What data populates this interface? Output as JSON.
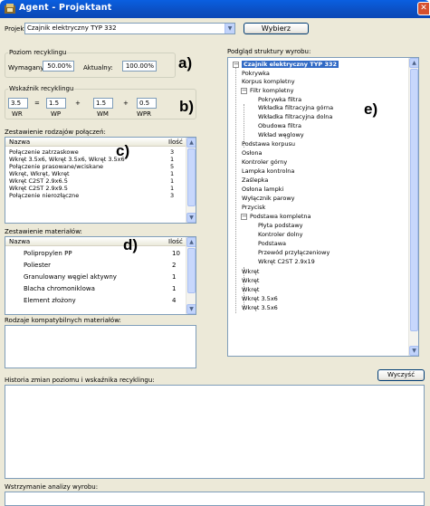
{
  "window": {
    "title": "Agent - Projektant",
    "close_glyph": "✕"
  },
  "project": {
    "label": "Projekt:",
    "value": "Czajnik elektryczny TYP 332",
    "browse_button": "Wybierz"
  },
  "recycling_level": {
    "group": "Poziom recyklingu",
    "required_label": "Wymagany:",
    "required_value": "50.00%",
    "current_label": "Aktualny:",
    "current_value": "100.00%"
  },
  "recycling_index": {
    "group": "Wskaźnik recyklingu",
    "values": [
      "3.5",
      "1.5",
      "1.5",
      "0.5"
    ],
    "operators": [
      "=",
      "+",
      "+"
    ],
    "labels": [
      "WR",
      "WP",
      "WM",
      "WPR"
    ]
  },
  "connections": {
    "title": "Zestawienie rodzajów połączeń:",
    "headers": [
      "Nazwa",
      "Ilość"
    ],
    "rows": [
      {
        "name": "Połączenie zatrzaskowe",
        "qty": "3"
      },
      {
        "name": "Wkręt 3.5x6, Wkręt 3.5x6, Wkręt 3.5x6",
        "qty": "1"
      },
      {
        "name": "Połączenie prasowane/wciskane",
        "qty": "5"
      },
      {
        "name": "Wkręt, Wkręt, Wkręt",
        "qty": "1"
      },
      {
        "name": "Wkręt C2ST 2.9x6.5",
        "qty": "1"
      },
      {
        "name": "Wkręt C2ST 2.9x9.5",
        "qty": "1"
      },
      {
        "name": "Połączenie nierozłączne",
        "qty": "3"
      }
    ]
  },
  "materials": {
    "title": "Zestawienie materiałów:",
    "headers": [
      "Nazwa",
      "Ilość"
    ],
    "rows": [
      {
        "name": "Polipropylen PP",
        "qty": "10"
      },
      {
        "name": "Poliester",
        "qty": "2"
      },
      {
        "name": "Granulowany węgiel aktywny",
        "qty": "1"
      },
      {
        "name": "Blacha chromoniklowa",
        "qty": "1"
      },
      {
        "name": "Element złożony",
        "qty": "4"
      }
    ]
  },
  "compatible": {
    "title": "Rodzaje kompatybilnych materiałów:"
  },
  "tree": {
    "title": "Podgląd struktury wyrobu:",
    "nodes": [
      {
        "label": "Czajnik elektryczny TYP 332",
        "level": 0,
        "toggle": "−",
        "selected": true
      },
      {
        "label": "Pokrywka",
        "level": 1
      },
      {
        "label": "Korpus kompletny",
        "level": 1
      },
      {
        "label": "Filtr kompletny",
        "level": 1,
        "toggle": "−"
      },
      {
        "label": "Pokrywka filtra",
        "level": 2
      },
      {
        "label": "Wkładka filtracyjna górna",
        "level": 2
      },
      {
        "label": "Wkładka filtracyjna dolna",
        "level": 2
      },
      {
        "label": "Obudowa filtra",
        "level": 2
      },
      {
        "label": "Wkład węglowy",
        "level": 2
      },
      {
        "label": "Podstawa korpusu",
        "level": 1
      },
      {
        "label": "Osłona",
        "level": 1
      },
      {
        "label": "Kontroler górny",
        "level": 1
      },
      {
        "label": "Lampka kontrolna",
        "level": 1
      },
      {
        "label": "Zaślepka",
        "level": 1
      },
      {
        "label": "Osłona lampki",
        "level": 1
      },
      {
        "label": "Wyłącznik parowy",
        "level": 1
      },
      {
        "label": "Przycisk",
        "level": 1
      },
      {
        "label": "Podstawa kompletna",
        "level": 1,
        "toggle": "−"
      },
      {
        "label": "Płyta podstawy",
        "level": 2
      },
      {
        "label": "Kontroler dolny",
        "level": 2
      },
      {
        "label": "Podstawa",
        "level": 2
      },
      {
        "label": "Przewód przyłączeniowy",
        "level": 2
      },
      {
        "label": "Wkręt C2ST 2.9x19",
        "level": 2
      },
      {
        "label": "Wkręt",
        "level": 1
      },
      {
        "label": "Wkręt",
        "level": 1
      },
      {
        "label": "Wkręt",
        "level": 1
      },
      {
        "label": "Wkręt 3.5x6",
        "level": 1
      },
      {
        "label": "Wkręt 3.5x6",
        "level": 1
      }
    ]
  },
  "history": {
    "title": "Historia zmian poziomu i wskaźnika recyklingu:",
    "clear_button": "Wyczyść"
  },
  "halt": {
    "title": "Wstrzymanie analizy wyrobu:"
  },
  "annotations": [
    "a)",
    "b)",
    "c)",
    "d)",
    "e)"
  ],
  "icons": {
    "app": "kettle-app-icon",
    "dropdown": "chevron-down-icon",
    "scroll_up": "scroll-up-arrow-icon",
    "scroll_down": "scroll-down-arrow-icon"
  }
}
